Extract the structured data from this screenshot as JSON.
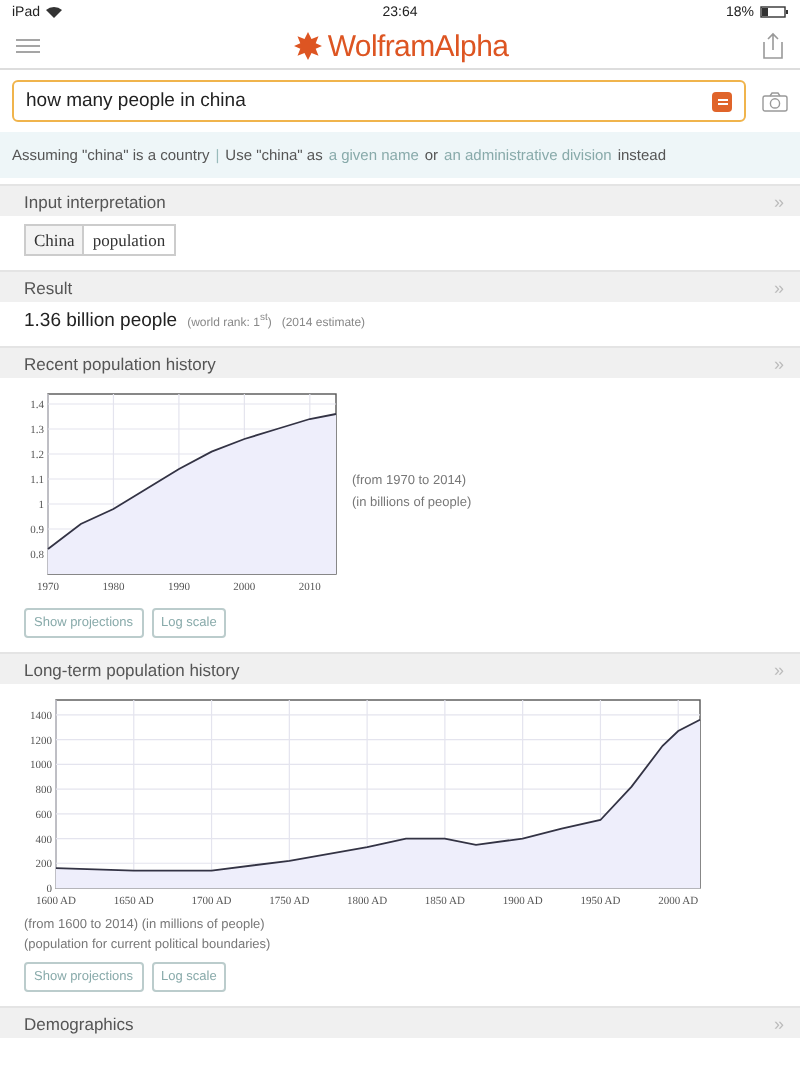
{
  "status_bar": {
    "device": "iPad",
    "time": "23:64",
    "battery": "18%"
  },
  "header": {
    "logo": "WolframAlpha"
  },
  "search": {
    "value": "how many people in china"
  },
  "assumption": {
    "text": "Assuming \"china\" is a country",
    "separator": "|",
    "alt_prefix": "Use \"china\" as",
    "options": [
      "a given name",
      "an administrative division"
    ],
    "joiner": "or",
    "suffix": "instead"
  },
  "pods": [
    {
      "kind": "chips",
      "title": "Input interpretation",
      "chevron": "»",
      "chips": [
        "China",
        "population"
      ]
    },
    {
      "kind": "result",
      "title": "Result",
      "chevron": "»",
      "value": "1.36 billion people",
      "rank_label": "(world rank: 1$^{st}$)",
      "note": "(2014 estimate)"
    },
    {
      "kind": "chart",
      "title": "Recent population history",
      "chevron": "»",
      "side_notes": [
        "(from 1970 to 2014)",
        "(in billions of people)"
      ],
      "buttons": [
        "Show projections",
        "Log scale"
      ],
      "chart_data": {
        "type": "area",
        "grid": true,
        "x": [
          1970,
          1975,
          1980,
          1985,
          1990,
          1995,
          2000,
          2005,
          2010,
          2014
        ],
        "series": [
          {
            "color": "#333344",
            "values": [
              0.82,
              0.92,
              0.98,
              1.06,
              1.14,
              1.21,
              1.26,
              1.3,
              1.34,
              1.36
            ]
          }
        ],
        "xlim": [
          1970,
          2014
        ],
        "ylim": [
          0.72,
          1.44
        ],
        "xticks": [
          1970,
          1980,
          1990,
          2000,
          2010
        ],
        "yticks": [
          0.8,
          0.9,
          1,
          1.1,
          1.2,
          1.3,
          1.4
        ]
      }
    },
    {
      "kind": "chart",
      "title": "Long-term population history",
      "chevron": "»",
      "notes": [
        "(from 1600 to 2014)  (in millions of people)",
        "(population for current political boundaries)"
      ],
      "buttons": [
        "Show projections",
        "Log scale"
      ],
      "chart_data": {
        "type": "area",
        "grid": true,
        "x": [
          1600,
          1650,
          1700,
          1750,
          1800,
          1825,
          1850,
          1870,
          1900,
          1925,
          1950,
          1970,
          1990,
          2000,
          2014
        ],
        "series": [
          {
            "color": "#333344",
            "values": [
              160,
              140,
              140,
              220,
              330,
              400,
              400,
              350,
              400,
              480,
              550,
              820,
              1150,
              1270,
              1360
            ]
          }
        ],
        "xlim": [
          1600,
          2014
        ],
        "ylim": [
          0,
          1520
        ],
        "xticks": [
          {
            "value": 1600,
            "label": "1600 AD"
          },
          {
            "value": 1650,
            "label": "1650 AD"
          },
          {
            "value": 1700,
            "label": "1700 AD"
          },
          {
            "value": 1750,
            "label": "1750 AD"
          },
          {
            "value": 1800,
            "label": "1800 AD"
          },
          {
            "value": 1850,
            "label": "1850 AD"
          },
          {
            "value": 1900,
            "label": "1900 AD"
          },
          {
            "value": 1950,
            "label": "1950 AD"
          },
          {
            "value": 2000,
            "label": "2000 AD"
          }
        ],
        "yticks": [
          0,
          200,
          400,
          600,
          800,
          1000,
          1200,
          1400
        ]
      }
    },
    {
      "kind": "collapsed",
      "title": "Demographics",
      "chevron": "»"
    }
  ]
}
